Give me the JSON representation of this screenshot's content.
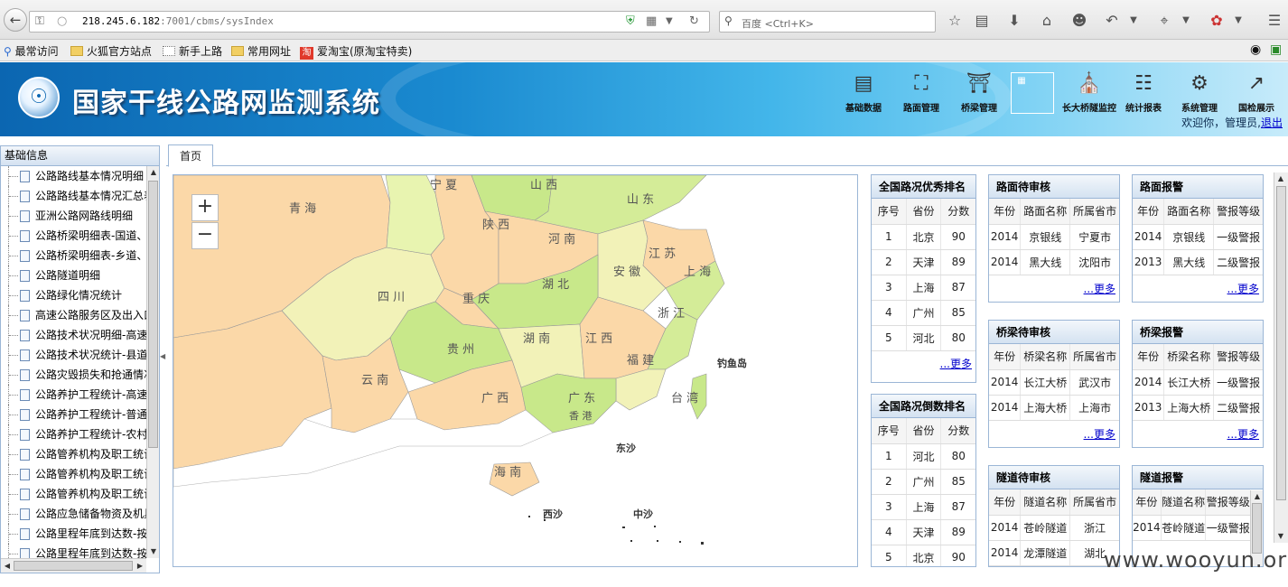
{
  "browser": {
    "url_host": "218.245.6.182",
    "url_path": ":7001/cbms/sysIndex",
    "search_placeholder": "百度 <Ctrl+K>",
    "icons": [
      "back-icon",
      "key-icon",
      "globe-icon",
      "shield-icon",
      "qr-icon",
      "dropdown-icon",
      "reload-icon",
      "search-icon",
      "star-icon",
      "reading-list-icon",
      "download-icon",
      "home-icon",
      "smiley-icon",
      "undo-icon",
      "crop-icon",
      "extension-icon",
      "menu-icon"
    ]
  },
  "bookmarks": [
    "最常访问",
    "火狐官方站点",
    "新手上路",
    "常用网址",
    "爱淘宝(原淘宝特卖)"
  ],
  "header": {
    "title": "国家干线公路网监测系统",
    "modules": [
      {
        "label": "基础数据",
        "icon": "database-icon"
      },
      {
        "label": "路面管理",
        "icon": "road-icon"
      },
      {
        "label": "桥梁管理",
        "icon": "bridge-icon"
      },
      {
        "label": "",
        "icon": "blank-module-icon"
      },
      {
        "label": "长大桥隧监控",
        "icon": "tunnel-monitor-icon"
      },
      {
        "label": "统计报表",
        "icon": "report-icon"
      },
      {
        "label": "系统管理",
        "icon": "gear-icon"
      },
      {
        "label": "国检展示",
        "icon": "chart-icon"
      }
    ],
    "welcome": "欢迎你，管理员,",
    "logout": "退出"
  },
  "sidebar": {
    "title": "基础信息",
    "items": [
      "公路路线基本情况明细",
      "公路路线基本情况汇总表",
      "亚洲公路网路线明细",
      "公路桥梁明细表-国道、",
      "公路桥梁明细表-乡道、",
      "公路隧道明细",
      "公路绿化情况统计",
      "高速公路服务区及出入口",
      "公路技术状况明细-高速",
      "公路技术状况统计-县道",
      "公路灾毁损失和抢通情况",
      "公路养护工程统计-高速",
      "公路养护工程统计-普通",
      "公路养护工程统计-农村",
      "公路管养机构及职工统计",
      "公路管养机构及职工统计",
      "公路管养机构及职工统计",
      "公路应急储备物资及机具",
      "公路里程年底到达数-按",
      "公路里程年底到达数-按"
    ]
  },
  "tabs": [
    "首页"
  ],
  "map": {
    "provinces": [
      "青 海",
      "宁 夏",
      "山 西",
      "山 东",
      "陕 西",
      "河 南",
      "江 苏",
      "安 徽",
      "上 海",
      "湖 北",
      "四 川",
      "重 庆",
      "浙 江",
      "贵 州",
      "湖 南",
      "江 西",
      "福 建",
      "云 南",
      "广 西",
      "广 东",
      "台 湾",
      "香 港",
      "海 南"
    ],
    "islands": [
      "钓鱼岛",
      "东沙",
      "西沙",
      "中沙"
    ]
  },
  "panels": {
    "top_rank": {
      "title": "全国路况优秀排名",
      "headers": [
        "序号",
        "省份",
        "分数"
      ],
      "rows": [
        [
          "1",
          "北京",
          "90"
        ],
        [
          "2",
          "天津",
          "89"
        ],
        [
          "3",
          "上海",
          "87"
        ],
        [
          "4",
          "广州",
          "85"
        ],
        [
          "5",
          "河北",
          "80"
        ]
      ],
      "more": "...更多"
    },
    "bottom_rank": {
      "title": "全国路况倒数排名",
      "headers": [
        "序号",
        "省份",
        "分数"
      ],
      "rows": [
        [
          "1",
          "河北",
          "80"
        ],
        [
          "2",
          "广州",
          "85"
        ],
        [
          "3",
          "上海",
          "87"
        ],
        [
          "4",
          "天津",
          "89"
        ],
        [
          "5",
          "北京",
          "90"
        ]
      ]
    },
    "road_review": {
      "title": "路面待审核",
      "headers": [
        "年份",
        "路面名称",
        "所属省市"
      ],
      "rows": [
        [
          "2014",
          "京银线",
          "宁夏市"
        ],
        [
          "2014",
          "黑大线",
          "沈阳市"
        ]
      ],
      "more": "...更多"
    },
    "road_alarm": {
      "title": "路面报警",
      "headers": [
        "年份",
        "路面名称",
        "警报等级"
      ],
      "rows": [
        [
          "2014",
          "京银线",
          "一级警报"
        ],
        [
          "2013",
          "黑大线",
          "二级警报"
        ]
      ],
      "more": "...更多"
    },
    "bridge_review": {
      "title": "桥梁待审核",
      "headers": [
        "年份",
        "桥梁名称",
        "所属省市"
      ],
      "rows": [
        [
          "2014",
          "长江大桥",
          "武汉市"
        ],
        [
          "2014",
          "上海大桥",
          "上海市"
        ]
      ],
      "more": "...更多"
    },
    "bridge_alarm": {
      "title": "桥梁报警",
      "headers": [
        "年份",
        "桥梁名称",
        "警报等级"
      ],
      "rows": [
        [
          "2014",
          "长江大桥",
          "一级警报"
        ],
        [
          "2013",
          "上海大桥",
          "二级警报"
        ]
      ],
      "more": "...更多"
    },
    "tunnel_review": {
      "title": "隧道待审核",
      "headers": [
        "年份",
        "隧道名称",
        "所属省市"
      ],
      "rows": [
        [
          "2014",
          "苍岭隧道",
          "浙江"
        ],
        [
          "2014",
          "龙潭隧道",
          "湖北"
        ]
      ]
    },
    "tunnel_alarm": {
      "title": "隧道报警",
      "headers": [
        "年份",
        "隧道名称",
        "警报等级"
      ],
      "rows": [
        [
          "2014",
          "苍岭隧道",
          "一级警报"
        ]
      ]
    }
  },
  "watermark": "www.wooyun.org"
}
